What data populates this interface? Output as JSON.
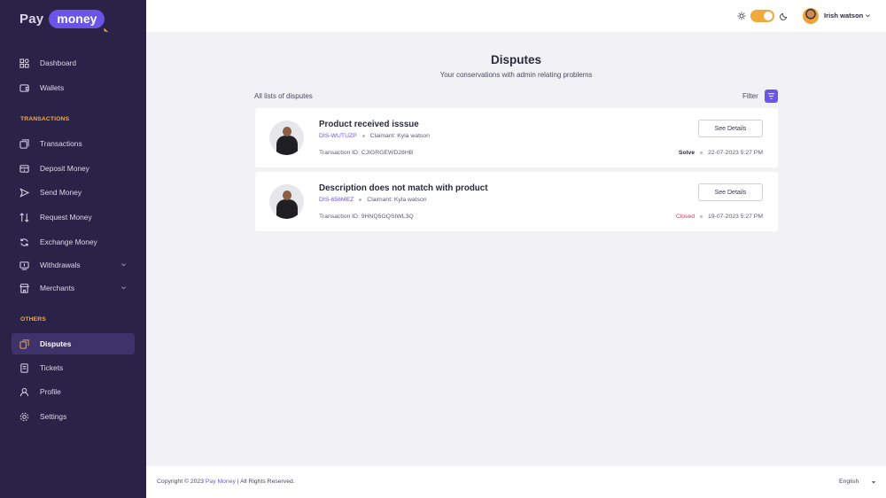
{
  "brand": {
    "pay": "Pay",
    "money": "money"
  },
  "sidebar": {
    "items_main": [
      {
        "label": "Dashboard",
        "icon": "dashboard-icon"
      },
      {
        "label": "Wallets",
        "icon": "wallet-icon"
      }
    ],
    "section_transactions": "TRANSACTIONS",
    "items_transactions": [
      {
        "label": "Transactions",
        "icon": "transactions-icon"
      },
      {
        "label": "Deposit Money",
        "icon": "deposit-icon"
      },
      {
        "label": "Send Money",
        "icon": "send-icon"
      },
      {
        "label": "Request Money",
        "icon": "request-icon"
      },
      {
        "label": "Exchange Money",
        "icon": "exchange-icon"
      },
      {
        "label": "Withdrawals",
        "icon": "withdrawals-icon"
      },
      {
        "label": "Merchants",
        "icon": "merchants-icon"
      }
    ],
    "section_others": "OTHERS",
    "items_others": [
      {
        "label": "Disputes",
        "icon": "disputes-icon",
        "active": true
      },
      {
        "label": "Tickets",
        "icon": "tickets-icon"
      },
      {
        "label": "Profile",
        "icon": "profile-icon"
      },
      {
        "label": "Settings",
        "icon": "settings-icon"
      }
    ]
  },
  "header": {
    "user_name": "Irish watson",
    "theme_toggle_on": true
  },
  "main": {
    "title": "Disputes",
    "subtitle": "Your conservations with admin relating problems",
    "list_label": "All lists of disputes",
    "filter_label": "Filter",
    "disputes": [
      {
        "title": "Product received isssue",
        "code": "DIS-WUTUZP",
        "claimant": "Claimant: Kyla watson",
        "transaction": "Transaction ID: CJIGRGEWD28HB",
        "status": "Solve",
        "date": "22-07-2023 5:27 PM",
        "button": "See Details"
      },
      {
        "title": "Description does not match with product",
        "code": "DIS-656MEZ",
        "claimant": "Claimant: Kyla watson",
        "transaction": "Transaction ID: 9HNQ5GQSIWL3Q",
        "status": "Closed",
        "date": "19-07-2023 5:27 PM",
        "button": "See Details"
      }
    ]
  },
  "footer": {
    "copyright_pre": "Copyright © 2023 ",
    "copyright_brand": "Pay Money",
    "copyright_post": " | All Rights Reserved.",
    "language": "English"
  },
  "colors": {
    "accent": "#6a55e8",
    "sidebar": "#2b2347",
    "orange": "#f2a93b",
    "closed": "#e0314b"
  }
}
